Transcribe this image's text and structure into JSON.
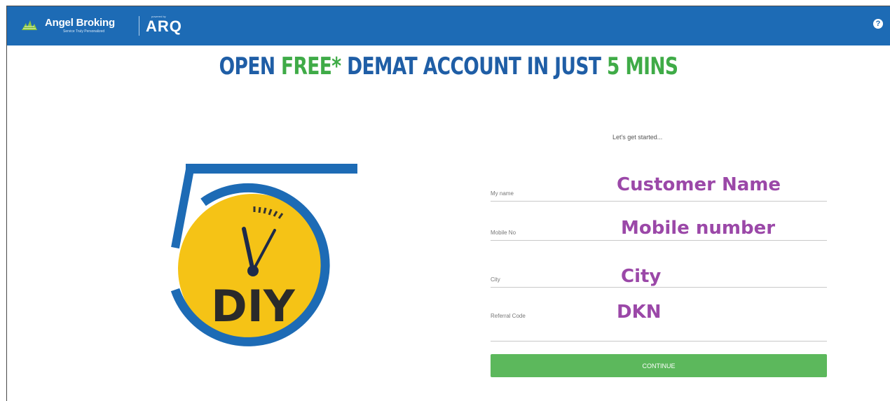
{
  "header": {
    "brand_name": "Angel Broking",
    "brand_tagline": "Service Truly Personalized",
    "product_small": "powered by",
    "product_name": "ARQ"
  },
  "headline": {
    "part1": "OPEN ",
    "part2": "FREE*",
    "part3": " DEMAT ACCOUNT IN JUST ",
    "part4": "5 MINS"
  },
  "logo": {
    "text": "DIY"
  },
  "form": {
    "intro": "Let's get started...",
    "fields": [
      {
        "label": "My name",
        "value": "Customer Name"
      },
      {
        "label": "Mobile No",
        "value": "Mobile number"
      },
      {
        "label": "City",
        "value": "City"
      },
      {
        "label": "Referral Code",
        "value": "DKN"
      }
    ],
    "continue_label": "CONTINUE"
  },
  "colors": {
    "header_bg": "#1d6bb5",
    "headline_blue": "#1f5ea6",
    "headline_green": "#3fab47",
    "field_value": "#9b48a8",
    "button_green": "#5cb85c",
    "logo_yellow": "#f5c316"
  }
}
